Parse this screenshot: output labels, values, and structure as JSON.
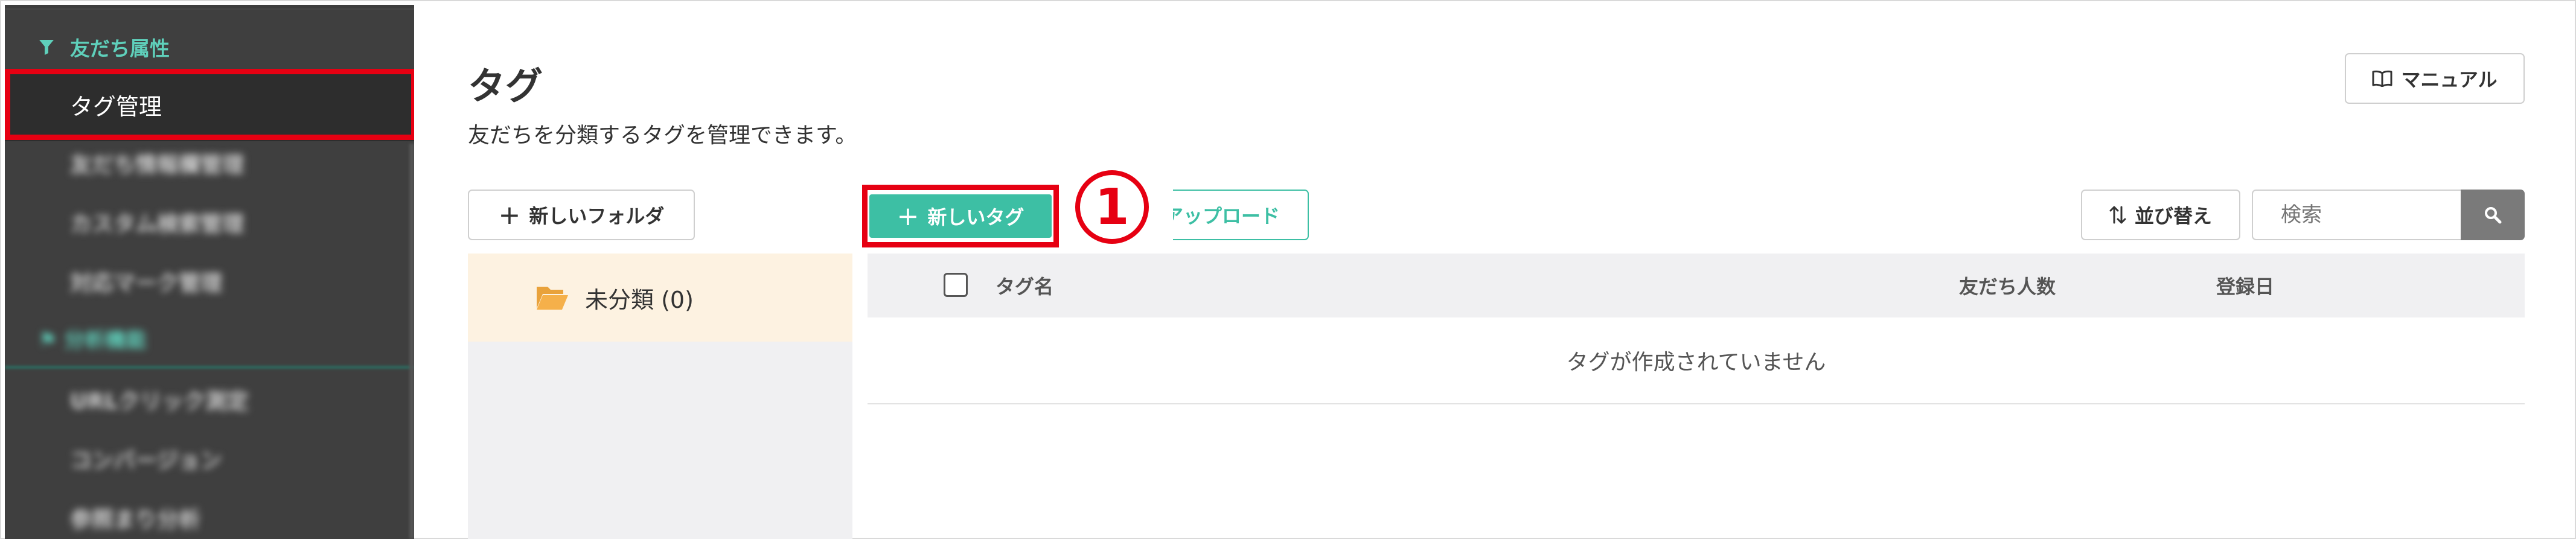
{
  "sidebar": {
    "section_friend_attr": "友だち属性",
    "items": [
      {
        "label": "タグ管理",
        "active": true
      },
      {
        "label": "友だち情報欄管理"
      },
      {
        "label": "カスタム検索管理"
      },
      {
        "label": "対応マーク管理"
      }
    ],
    "section_analysis": "分析機能",
    "analysis_items": [
      {
        "label": "URLクリック測定"
      },
      {
        "label": "コンバージョン"
      },
      {
        "label": "参照まり分析"
      }
    ],
    "accent_color": "#5fd0bb"
  },
  "header": {
    "title": "タグ",
    "subtitle": "友だちを分類するタグを管理できます。",
    "manual_label": "マニュアル"
  },
  "toolbar": {
    "new_folder_label": "新しいフォルダ",
    "new_tag_label": "新しいタグ",
    "upload_label": "アップロード",
    "sort_label": "並び替え",
    "search_placeholder": "検索"
  },
  "annotation": {
    "step": "1",
    "highlight_color": "#e60012"
  },
  "folders": [
    {
      "label": "未分類 (0)"
    }
  ],
  "table": {
    "columns": [
      "タグ名",
      "友だち人数",
      "登録日"
    ],
    "empty_message": "タグが作成されていません"
  },
  "colors": {
    "primary": "#3dbfa4",
    "sidebar_bg": "#3f3f3f",
    "folder_selected_bg": "#fdf2e1"
  }
}
